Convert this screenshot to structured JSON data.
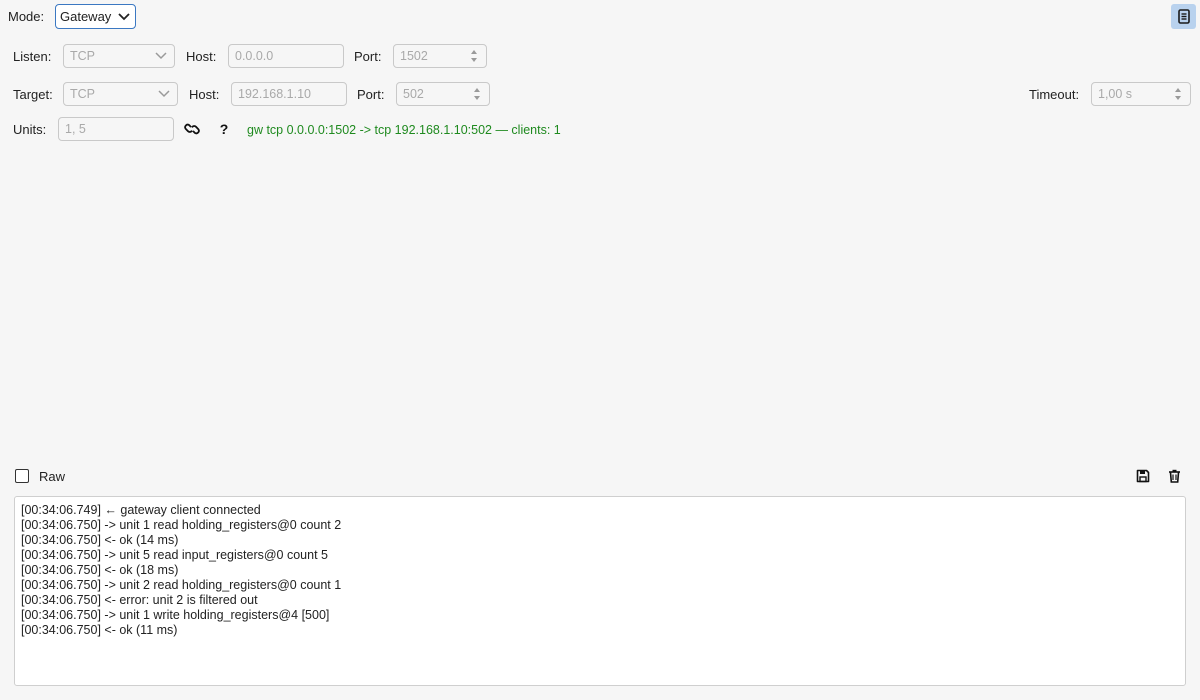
{
  "mode": {
    "label": "Mode:",
    "value": "Gateway"
  },
  "listen": {
    "label": "Listen:",
    "protocol": "TCP",
    "host_label": "Host:",
    "host": "0.0.0.0",
    "port_label": "Port:",
    "port": "1502"
  },
  "target": {
    "label": "Target:",
    "protocol": "TCP",
    "host_label": "Host:",
    "host": "192.168.1.10",
    "port_label": "Port:",
    "port": "502",
    "timeout_label": "Timeout:",
    "timeout": "1,00 s"
  },
  "units": {
    "label": "Units:",
    "value": "1, 5"
  },
  "help_label": "?",
  "status": {
    "text": "gw tcp 0.0.0.0:1502 -> tcp 192.168.1.10:502 — clients: 1",
    "color": "#1f8a1f"
  },
  "raw": {
    "label": "Raw",
    "checked": false
  },
  "log": [
    "[00:34:06.749] ← gateway client connected",
    "[00:34:06.750] -> unit 1 read holding_registers@0 count 2",
    "[00:34:06.750] <- ok (14 ms)",
    "[00:34:06.750] -> unit 5 read input_registers@0 count 5",
    "[00:34:06.750] <- ok (18 ms)",
    "[00:34:06.750] -> unit 2 read holding_registers@0 count 1",
    "[00:34:06.750] <- error: unit 2 is filtered out",
    "[00:34:06.750] -> unit 1 write holding_registers@4 [500]",
    "[00:34:06.750] <- ok (11 ms)"
  ],
  "icons": {
    "doc_toggle": "document-icon",
    "link": "link-icon",
    "save": "save-icon",
    "clear": "trash-icon"
  },
  "colors": {
    "accent": "#3b78c2",
    "status": "#1f8a1f"
  }
}
